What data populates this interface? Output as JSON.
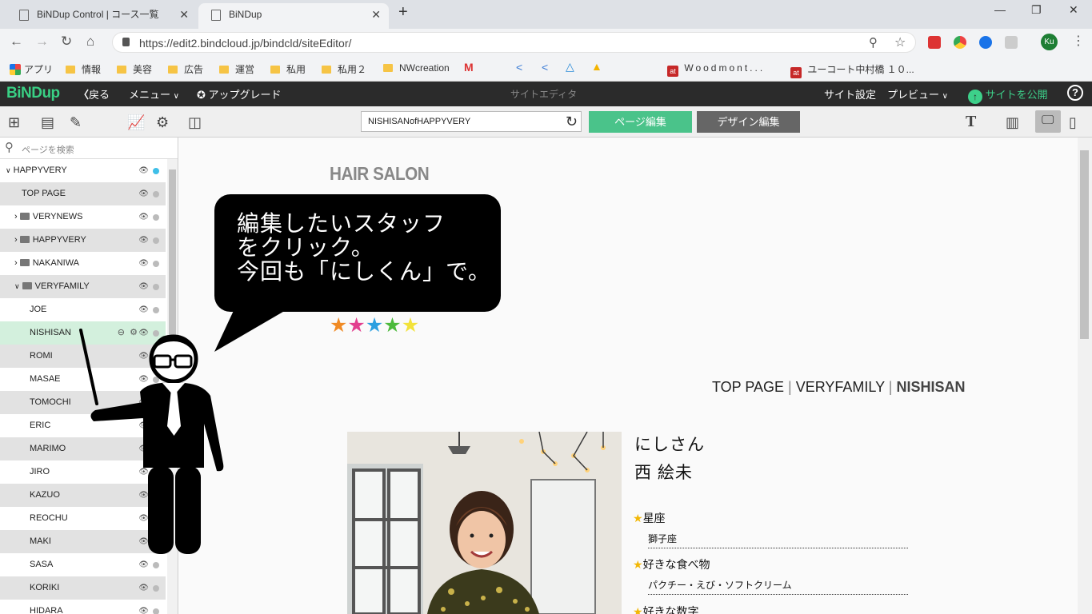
{
  "browser": {
    "tabs": [
      {
        "title": "BiNDup Control | コース一覧"
      },
      {
        "title": "BiNDup"
      }
    ],
    "url": "https://edit2.bindcloud.jp/bindcld/siteEditor/",
    "account_badge": "Ku",
    "bookmarks": [
      {
        "label": "アプリ",
        "icon": "apps-icon"
      },
      {
        "label": "情報",
        "icon": "folder-icon"
      },
      {
        "label": "美容",
        "icon": "folder-icon"
      },
      {
        "label": "広告",
        "icon": "folder-icon"
      },
      {
        "label": "運営",
        "icon": "folder-icon"
      },
      {
        "label": "私用",
        "icon": "folder-icon"
      },
      {
        "label": "私用２",
        "icon": "folder-icon"
      },
      {
        "label": "NWcreation",
        "icon": "folder-icon"
      },
      {
        "label": "Woodmont...",
        "icon": "at-icon"
      },
      {
        "label": "ユーコート中村橋 １０...",
        "icon": "at-icon"
      }
    ]
  },
  "app_header": {
    "logo": "BiNDup",
    "back": "戻る",
    "menu": "メニュー",
    "upgrade": "アップグレード",
    "center_title": "サイトエディタ",
    "site_settings": "サイト設定",
    "preview": "プレビュー",
    "publish": "サイトを公開",
    "help": "?"
  },
  "toolbar": {
    "page_select": "NISHISANofHAPPYVERY",
    "page_edit": "ページ編集",
    "design_edit": "デザイン編集"
  },
  "sidebar": {
    "search_placeholder": "ページを検索",
    "items": [
      {
        "label": "HAPPYVERY"
      },
      {
        "label": "TOP PAGE"
      },
      {
        "label": "VERYNEWS"
      },
      {
        "label": "HAPPYVERY"
      },
      {
        "label": "NAKANIWA"
      },
      {
        "label": "VERYFAMILY"
      },
      {
        "label": "JOE"
      },
      {
        "label": "NISHISAN"
      },
      {
        "label": "ROMI"
      },
      {
        "label": "MASAE"
      },
      {
        "label": "TOMOCHI"
      },
      {
        "label": "ERIC"
      },
      {
        "label": "MARIMO"
      },
      {
        "label": "JIRO"
      },
      {
        "label": "KAZUO"
      },
      {
        "label": "REOCHU"
      },
      {
        "label": "MAKI"
      },
      {
        "label": "SASA"
      },
      {
        "label": "KORIKI"
      },
      {
        "label": "HIDARA"
      }
    ]
  },
  "canvas": {
    "salon_title": "HAIR SALON",
    "stars": "★★★★★",
    "breadcrumb": {
      "a": "TOP PAGE",
      "sep": " | ",
      "b": "VERYFAMILY",
      "c": "NISHISAN"
    },
    "nickname": "にしさん",
    "fullname": "西 絵未",
    "profile": [
      {
        "q": "星座",
        "a": "獅子座"
      },
      {
        "q": "好きな食べ物",
        "a": "パクチー・えび・ソフトクリーム"
      },
      {
        "q": "好きな数字",
        "a": ""
      }
    ]
  },
  "overlay": {
    "bubble_lines": [
      "編集したいスタッフ",
      "をクリック。",
      "今回も「にしくん」で。"
    ]
  }
}
